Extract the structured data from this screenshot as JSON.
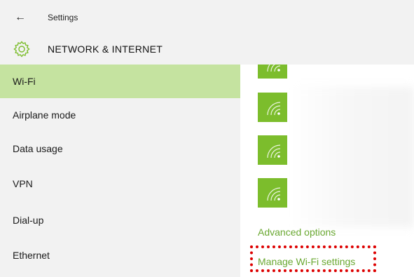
{
  "window": {
    "title": "Settings",
    "back_icon": "back-arrow-icon"
  },
  "header": {
    "icon": "gear-icon",
    "title": "NETWORK & INTERNET"
  },
  "sidebar": {
    "items": [
      {
        "label": "Wi-Fi",
        "selected": true
      },
      {
        "label": "Airplane mode",
        "selected": false
      },
      {
        "label": "Data usage",
        "selected": false
      },
      {
        "label": "VPN",
        "selected": false
      },
      {
        "label": "Dial-up",
        "selected": false
      },
      {
        "label": "Ethernet",
        "selected": false
      }
    ]
  },
  "content": {
    "network_icon": "wifi-signal-icon",
    "networks_count_visible": 4,
    "advanced_options_label": "Advanced options",
    "manage_wifi_label": "Manage Wi-Fi settings"
  },
  "colors": {
    "accent": "#7cbd2c",
    "selected_bg": "#c5e3a0",
    "link": "#6aa832",
    "highlight": "#dd0000"
  }
}
